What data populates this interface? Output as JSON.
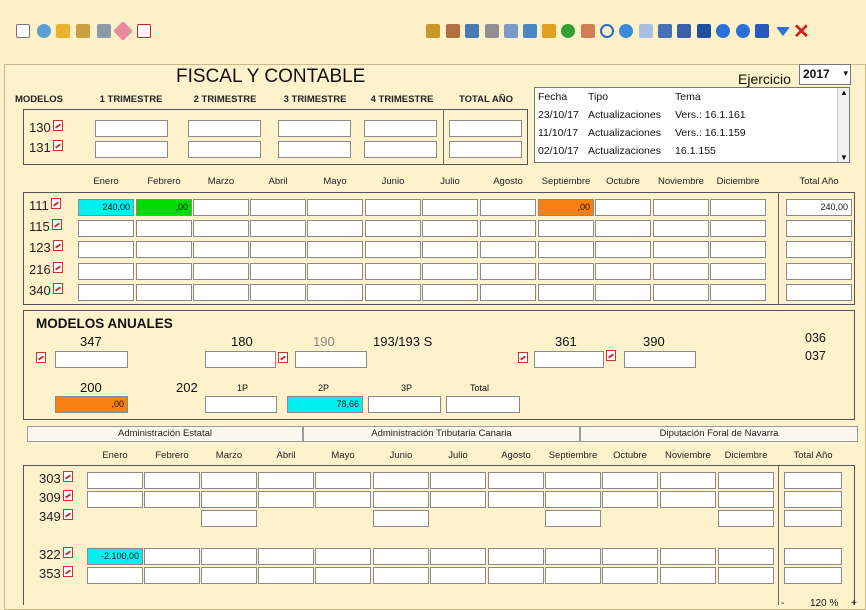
{
  "title": "FISCAL Y CONTABLE",
  "ejercicio": {
    "label": "Ejercicio",
    "value": "2017"
  },
  "toolbar_left_icons": [
    "new-doc-icon",
    "search-icon",
    "edit-icon",
    "bank-icon",
    "calculator-icon",
    "eraser-icon",
    "pdf-icon"
  ],
  "toolbar_right_icons": [
    "binoculars-icon",
    "users-icon",
    "report-icon",
    "tools-icon",
    "link-icon",
    "folder-icon",
    "save-icon",
    "check-icon",
    "group-icon",
    "undo-icon",
    "refresh-icon",
    "notes-icon",
    "chart-icon",
    "book-icon",
    "graduate-icon",
    "info-icon",
    "help-icon",
    "bookmark-icon",
    "dropdown-icon",
    "close-icon"
  ],
  "quarterly": {
    "headers": [
      "MODELOS",
      "1 TRIMESTRE",
      "2 TRIMESTRE",
      "3 TRIMESTRE",
      "4 TRIMESTRE",
      "TOTAL AÑO"
    ],
    "rows": [
      {
        "label": "130",
        "values": [
          "",
          "",
          "",
          "",
          ""
        ]
      },
      {
        "label": "131",
        "values": [
          "",
          "",
          "",
          "",
          ""
        ]
      }
    ]
  },
  "log": {
    "headers": [
      "Fecha",
      "Tipo",
      "Tema"
    ],
    "rows": [
      [
        "23/10/17",
        "Actualizaciones",
        "Vers.: 16.1.161"
      ],
      [
        "11/10/17",
        "Actualizaciones",
        "Vers.: 16.1.159"
      ],
      [
        "02/10/17",
        "Actualizaciones",
        "16.1.155"
      ]
    ]
  },
  "monthly": {
    "months": [
      "Enero",
      "Febrero",
      "Marzo",
      "Abril",
      "Mayo",
      "Junio",
      "Julio",
      "Agosto",
      "Septiembre",
      "Octubre",
      "Noviembre",
      "Diciembre"
    ],
    "total_label": "Total Año",
    "rows": [
      {
        "label": "111",
        "values": [
          "240,00",
          ",00",
          "",
          "",
          "",
          "",
          "",
          "",
          ",00",
          "",
          "",
          ""
        ],
        "total": "240,00"
      },
      {
        "label": "115",
        "values": [
          "",
          "",
          "",
          "",
          "",
          "",
          "",
          "",
          "",
          "",
          "",
          ""
        ],
        "total": ""
      },
      {
        "label": "123",
        "values": [
          "",
          "",
          "",
          "",
          "",
          "",
          "",
          "",
          "",
          "",
          "",
          ""
        ],
        "total": ""
      },
      {
        "label": "216",
        "values": [
          "",
          "",
          "",
          "",
          "",
          "",
          "",
          "",
          "",
          "",
          "",
          ""
        ],
        "total": ""
      },
      {
        "label": "340",
        "values": [
          "",
          "",
          "",
          "",
          "",
          "",
          "",
          "",
          "",
          "",
          "",
          ""
        ],
        "total": ""
      }
    ]
  },
  "anuales": {
    "title": "MODELOS ANUALES",
    "m347": "347",
    "m180": "180",
    "m190": "190",
    "m193": "193/193 S",
    "m361": "361",
    "m390": "390",
    "m036": "036",
    "m037": "037",
    "m200": "200",
    "m200_value": ",00",
    "m202": "202",
    "p1": "1P",
    "p2": "2P",
    "p3": "3P",
    "total": "Total",
    "p2_value": "78,66"
  },
  "tabs": [
    "Administración Estatal",
    "Administración Tributaria Canaria",
    "Diputación Foral de Navarra"
  ],
  "bottom": {
    "months": [
      "Enero",
      "Febrero",
      "Marzo",
      "Abril",
      "Mayo",
      "Junio",
      "Julio",
      "Agosto",
      "Septiembre",
      "Octubre",
      "Noviembre",
      "Diciembre"
    ],
    "total_label": "Total Año",
    "r303": "303",
    "r309": "309",
    "r349": "349",
    "r322": "322",
    "r353": "353",
    "r322_value": "-2.100,00"
  },
  "status": {
    "zoom": "120 %",
    "minus": "-",
    "plus": "+"
  },
  "colors": {
    "cyan": "#00f0f0",
    "green": "#00dc00",
    "orange": "#f78010",
    "bg": "#fcf0c8"
  }
}
